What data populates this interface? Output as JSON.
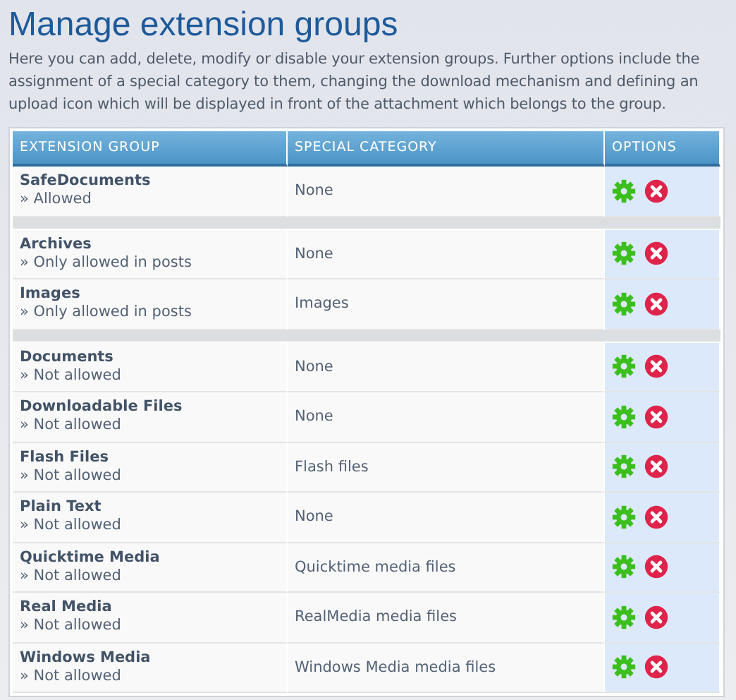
{
  "title": "Manage extension groups",
  "description": "Here you can add, delete, modify or disable your extension groups. Further options include the assignment of a special category to them, changing the download mechanism and defining an upload icon which will be displayed in front of the attachment which belongs to the group.",
  "table": {
    "columns": [
      "EXTENSION GROUP",
      "SPECIAL CATEGORY",
      "OPTIONS"
    ],
    "rows": [
      {
        "kind": "group",
        "name": "SafeDocuments",
        "status": "» Allowed",
        "category": "None"
      },
      {
        "kind": "spacer"
      },
      {
        "kind": "group",
        "name": "Archives",
        "status": "» Only allowed in posts",
        "category": "None"
      },
      {
        "kind": "group",
        "name": "Images",
        "status": "» Only allowed in posts",
        "category": "Images"
      },
      {
        "kind": "spacer"
      },
      {
        "kind": "group",
        "name": "Documents",
        "status": "» Not allowed",
        "category": "None"
      },
      {
        "kind": "group",
        "name": "Downloadable Files",
        "status": "» Not allowed",
        "category": "None"
      },
      {
        "kind": "group",
        "name": "Flash Files",
        "status": "» Not allowed",
        "category": "Flash files"
      },
      {
        "kind": "group",
        "name": "Plain Text",
        "status": "» Not allowed",
        "category": "None"
      },
      {
        "kind": "group",
        "name": "Quicktime Media",
        "status": "» Not allowed",
        "category": "Quicktime media files"
      },
      {
        "kind": "group",
        "name": "Real Media",
        "status": "» Not allowed",
        "category": "RealMedia media files"
      },
      {
        "kind": "group",
        "name": "Windows Media",
        "status": "» Not allowed",
        "category": "Windows Media media files"
      }
    ]
  }
}
